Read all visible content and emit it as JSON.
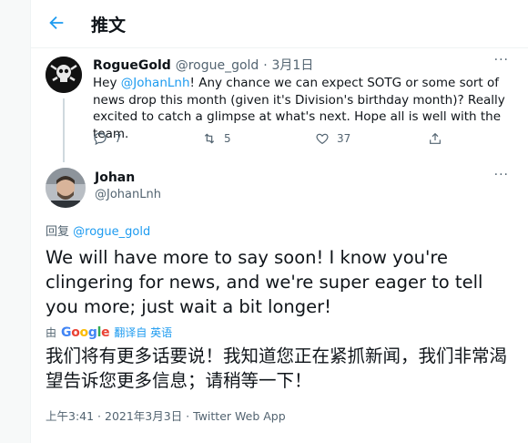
{
  "header": {
    "back_icon": "arrow-left-icon",
    "title": "推文"
  },
  "parent_tweet": {
    "name": "RogueGold",
    "handle": "@rogue_gold",
    "date": "3月1日",
    "text_pre": "Hey ",
    "mention": "@JohanLnh",
    "text_post": "! Any chance we can expect SOTG or some sort of news drop this month (given it's Division's birthday month)? Really excited to catch a glimpse at what's next. Hope all is well with the team.",
    "replies": "7",
    "retweets": "5",
    "likes": "37",
    "more_label": "···"
  },
  "focused_tweet": {
    "name": "Johan",
    "handle": "@JohanLnh",
    "more_label": "···",
    "reply_prefix": "回复 ",
    "reply_to": "@rogue_gold",
    "text": "We will have more to say soon! I know you're clingering for news, and we're super eager to tell you more; just wait a bit longer!",
    "translated_by": "由",
    "google": {
      "G": "G",
      "o1": "o",
      "o2": "o",
      "g": "g",
      "l": "l",
      "e": "e"
    },
    "translated_from": "翻译自 英语",
    "translation": "我们将有更多话要说！我知道您正在紧抓新闻，我们非常渴望告诉您更多信息；请稍等一下！",
    "meta": "上午3:41 · 2021年3月3日 · Twitter Web App"
  },
  "colors": {
    "accent": "#1d9bf0",
    "secondary_text": "#536471",
    "border": "#eff3f4"
  }
}
